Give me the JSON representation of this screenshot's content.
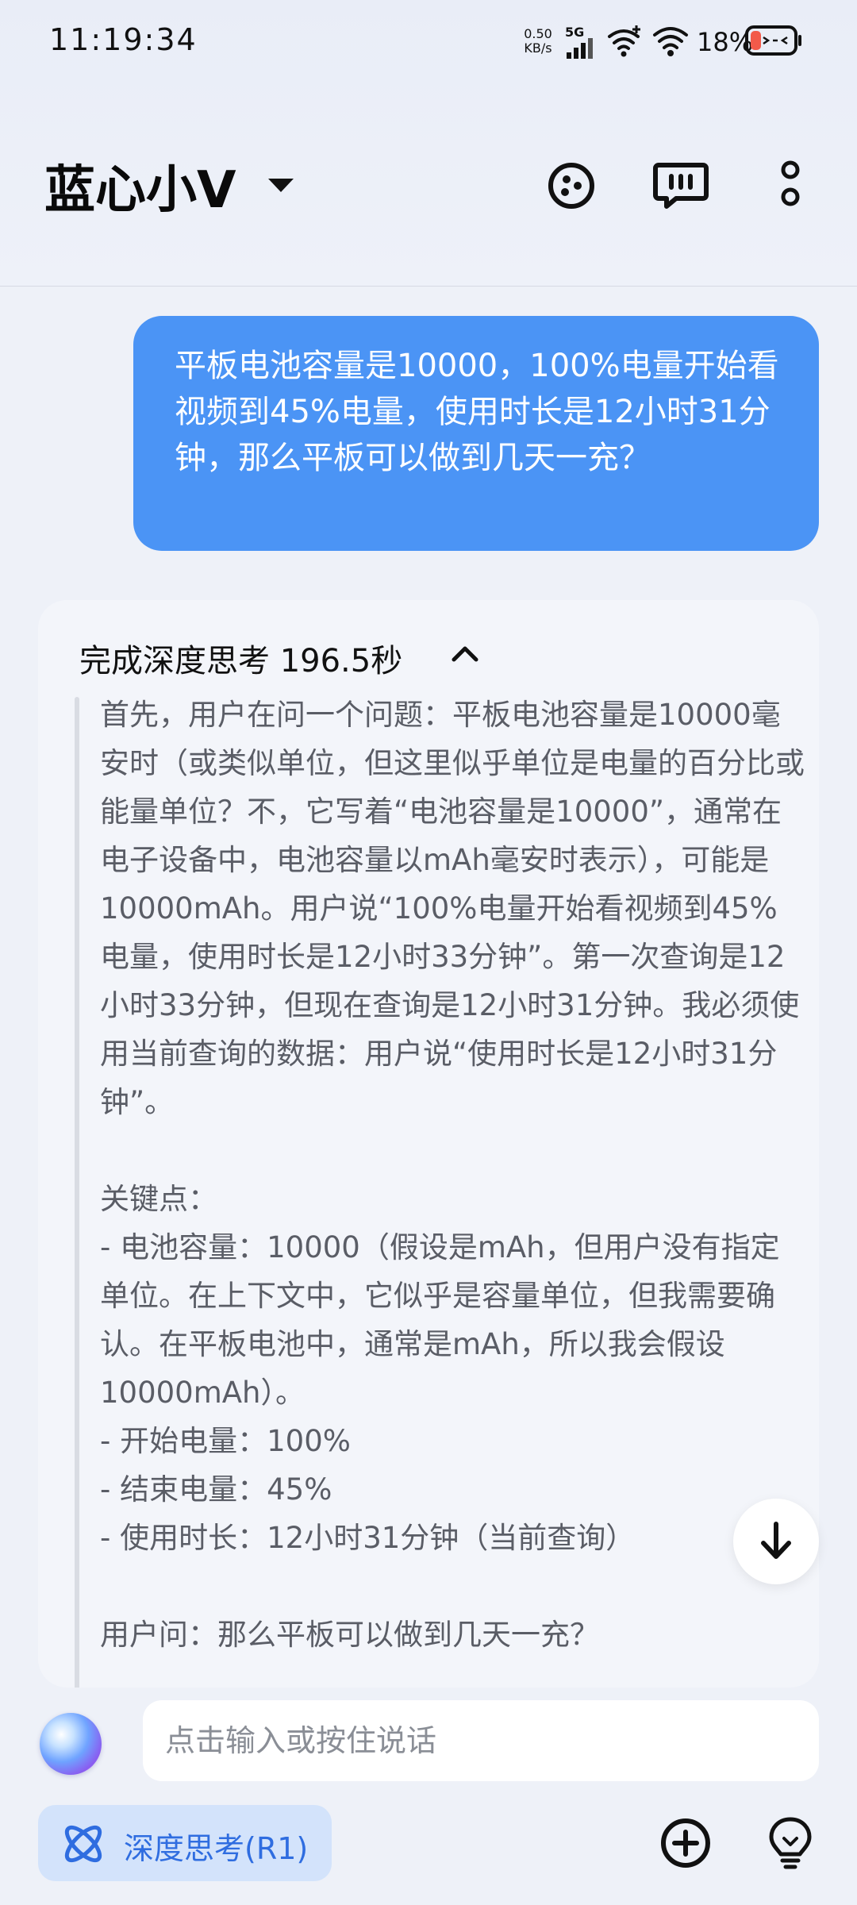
{
  "status_bar": {
    "time": "11:19:34",
    "net_speed_value": "0.50",
    "net_speed_unit": "KB/s",
    "network_type": "5G",
    "battery_percent": "18%"
  },
  "header": {
    "title": "蓝心小V"
  },
  "user_message": {
    "text": "平板电池容量是10000，100%电量开始看视频到45%电量，使用时长是12小时31分钟，那么平板可以做到几天一充？"
  },
  "answer": {
    "think_header": "完成深度思考 196.5秒",
    "paragraph1": "首先，用户在问一个问题：平板电池容量是10000毫安时（或类似单位，但这里似乎单位是电量的百分比或能量单位？不，它写着“电池容量是10000”，通常在电子设备中，电池容量以mAh毫安时表示），可能是10000mAh。用户说“100%电量开始看视频到45%电量，使用时长是12小时33分钟”。第一次查询是12小时33分钟，但现在查询是12小时31分钟。我必须使用当前查询的数据：用户说“使用时长是12小时31分钟”。",
    "key_points_title": "关键点：",
    "key_point1": "- 电池容量：10000（假设是mAh，但用户没有指定单位。在上下文中，它似乎是容量单位，但我需要确认。在平板电池中，通常是mAh，所以我会假设10000mAh）。",
    "key_point2": "- 开始电量：100%",
    "key_point3": "- 结束电量：45%",
    "key_point4": "- 使用时长：12小时31分钟（当前查询）",
    "question_line": "用户问：那么平板可以做到几天一充？"
  },
  "input": {
    "placeholder": "点击输入或按住说话"
  },
  "deep_think": {
    "label": "深度思考(R1)"
  },
  "colors": {
    "bubble_blue": "#4b94f5",
    "accent_blue": "#2f6de0",
    "chip_bg": "#d3e3fb"
  },
  "icons": {
    "title_menu": "caret-down-icon",
    "header_buttons": [
      "mask-face-icon",
      "message-square-icon",
      "more-vertical-icon"
    ],
    "collapse": "chevron-up-icon",
    "scroll": "arrow-down-icon",
    "bottom_buttons": [
      "plus-circle-icon",
      "lightbulb-icon"
    ]
  }
}
